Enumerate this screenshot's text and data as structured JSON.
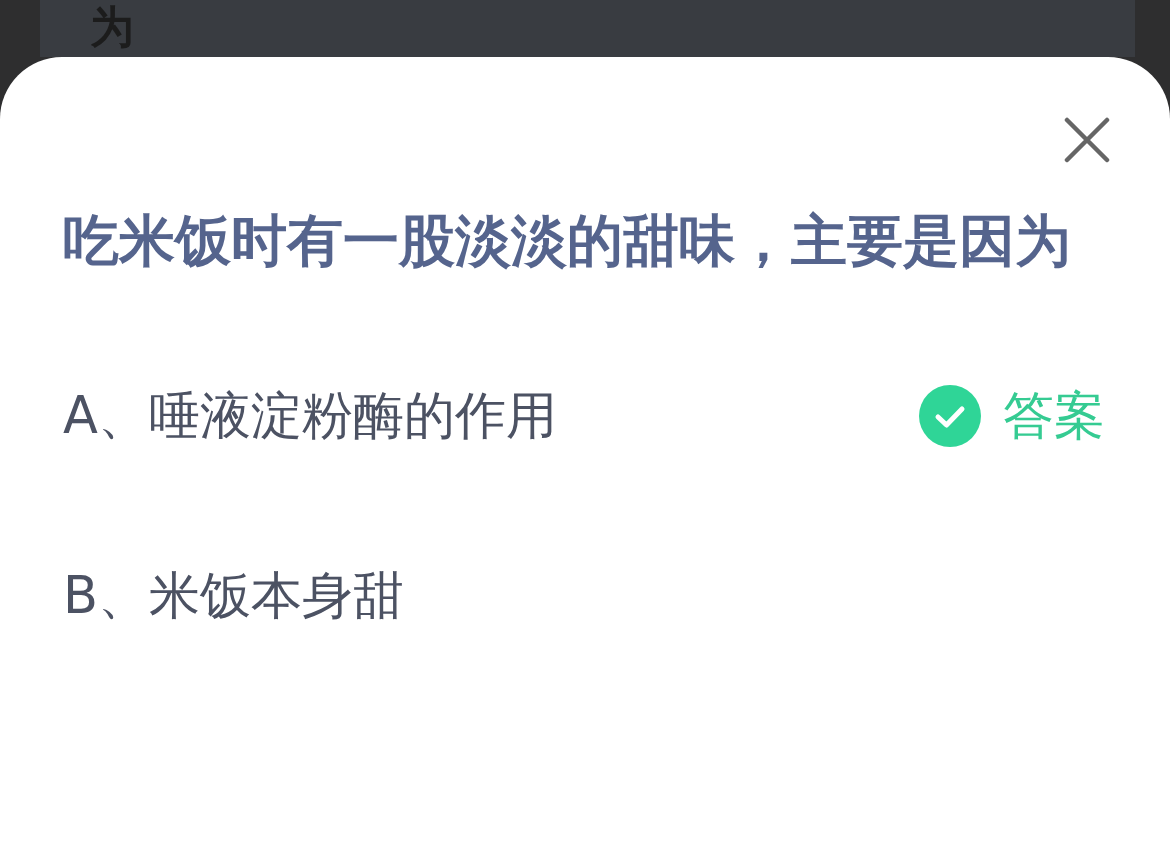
{
  "backdrop": {
    "text": "为"
  },
  "sheet": {
    "question": "吃米饭时有一股淡淡的甜味，主要是因为",
    "answer_label": "答案",
    "options": [
      {
        "label": "A、唾液淀粉酶的作用",
        "correct": true
      },
      {
        "label": "B、米饭本身甜",
        "correct": false
      }
    ]
  }
}
